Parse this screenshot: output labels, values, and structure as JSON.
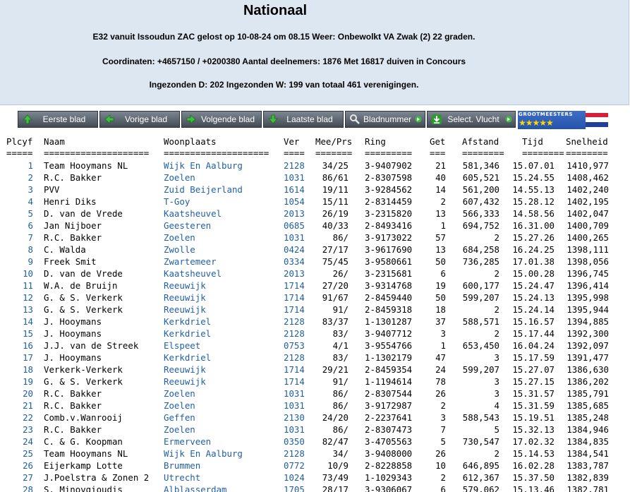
{
  "header": {
    "title": "Nationaal",
    "line1": "E32 vanuit Issoudun ZAC gelost op 10-08-24 om 08.15 Weer: Onbewolkt VA Zwak (2) 22 graden.",
    "line2": "Coordinaten: +4657150 / +0200380 Aantal deelnemers: 1876 Met 16817 duiven in Concours",
    "line3": "Ingezonden D: 202 Ingezonden W: 199 van totaal 461 verenigingen."
  },
  "toolbar": {
    "first": "Eerste blad",
    "prev": "Vorige blad",
    "next": "Volgende blad",
    "last": "Laatste blad",
    "page": "Bladnummer",
    "select": "Select. Vlucht"
  },
  "badge": {
    "text": "GROOTMEESTERS",
    "stars": "★★★★★"
  },
  "colors": {
    "header_bg": "#dde7f1",
    "link": "#2060a8",
    "ver": "#1f5fa0",
    "button": "#555f69"
  },
  "table": {
    "headers": {
      "plcyf": "Plcyf",
      "naam": "Naam",
      "woonplaats": "Woonplaats",
      "ver": "Ver",
      "meeprs": "Mee/Prs",
      "ring": "Ring",
      "get": "Get",
      "afstand": "Afstand",
      "tijd": "Tijd",
      "snelheid": "Snelheid"
    },
    "underlines": {
      "plcyf": "=====",
      "naam": "====================",
      "woonplaats": "====================",
      "ver": "====",
      "meeprs": "=======",
      "ring": "=========",
      "get": "===",
      "afstand": "========",
      "tijd": "========",
      "snelheid": "========"
    },
    "rows": [
      {
        "pl": "1",
        "naam": "Team Hooymans NL",
        "woon": "Wijk En Aalburg",
        "ver": "2128",
        "mp": "34/25",
        "ring": "3-9407902",
        "get": "21",
        "afst": "581,346",
        "tijd": "15.07.01",
        "snel": "1410,977"
      },
      {
        "pl": "2",
        "naam": "R.C. Bakker",
        "woon": "Zoelen",
        "ver": "1031",
        "mp": "86/61",
        "ring": "2-8307598",
        "get": "40",
        "afst": "605,521",
        "tijd": "15.24.55",
        "snel": "1408,462"
      },
      {
        "pl": "3",
        "naam": "PVV",
        "woon": "Zuid Beijerland",
        "ver": "1614",
        "mp": "19/11",
        "ring": "3-9284562",
        "get": "14",
        "afst": "561,200",
        "tijd": "14.55.13",
        "snel": "1402,240"
      },
      {
        "pl": "4",
        "naam": "Henri Diks",
        "woon": "T-Goy",
        "ver": "1054",
        "mp": "15/11",
        "ring": "2-8314459",
        "get": "2",
        "afst": "607,432",
        "tijd": "15.28.12",
        "snel": "1402,195"
      },
      {
        "pl": "5",
        "naam": "D. van de Vrede",
        "woon": "Kaatsheuvel",
        "ver": "2013",
        "mp": "26/19",
        "ring": "3-2315820",
        "get": "13",
        "afst": "566,333",
        "tijd": "14.58.56",
        "snel": "1402,047"
      },
      {
        "pl": "6",
        "naam": "Jan Nijboer",
        "woon": "Geesteren",
        "ver": "0685",
        "mp": "40/33",
        "ring": "2-8493416",
        "get": "1",
        "afst": "694,752",
        "tijd": "16.31.00",
        "snel": "1400,709"
      },
      {
        "pl": "7",
        "naam": "R.C. Bakker",
        "woon": "Zoelen",
        "ver": "1031",
        "mp": "86/",
        "ring": "3-9173022",
        "get": "57",
        "afst": "2",
        "tijd": "15.27.26",
        "snel": "1400,265"
      },
      {
        "pl": "8",
        "naam": "C. Walda",
        "woon": "Zwolle",
        "ver": "0424",
        "mp": "27/17",
        "ring": "3-9617690",
        "get": "13",
        "afst": "684,258",
        "tijd": "16.24.25",
        "snel": "1398,111"
      },
      {
        "pl": "9",
        "naam": "Freek Smit",
        "woon": "Zwartemeer",
        "ver": "0334",
        "mp": "75/45",
        "ring": "3-9580661",
        "get": "50",
        "afst": "736,285",
        "tijd": "17.01.38",
        "snel": "1398,056"
      },
      {
        "pl": "10",
        "naam": "D. van de Vrede",
        "woon": "Kaatsheuvel",
        "ver": "2013",
        "mp": "26/",
        "ring": "3-2315681",
        "get": "6",
        "afst": "2",
        "tijd": "15.00.28",
        "snel": "1396,745"
      },
      {
        "pl": "11",
        "naam": "W.A. de Bruijn",
        "woon": "Reeuwijk",
        "ver": "1714",
        "mp": "27/20",
        "ring": "3-9314768",
        "get": "19",
        "afst": "600,177",
        "tijd": "15.24.47",
        "snel": "1396,414"
      },
      {
        "pl": "12",
        "naam": "G. & S. Verkerk",
        "woon": "Reeuwijk",
        "ver": "1714",
        "mp": "91/67",
        "ring": "2-8459440",
        "get": "50",
        "afst": "599,207",
        "tijd": "15.24.13",
        "snel": "1395,998"
      },
      {
        "pl": "13",
        "naam": "G. & S. Verkerk",
        "woon": "Reeuwijk",
        "ver": "1714",
        "mp": "91/",
        "ring": "2-8459318",
        "get": "18",
        "afst": "2",
        "tijd": "15.24.14",
        "snel": "1395,944"
      },
      {
        "pl": "14",
        "naam": "J. Hooymans",
        "woon": "Kerkdriel",
        "ver": "2128",
        "mp": "83/37",
        "ring": "1-1301287",
        "get": "37",
        "afst": "588,571",
        "tijd": "15.16.57",
        "snel": "1394,885"
      },
      {
        "pl": "15",
        "naam": "J. Hooymans",
        "woon": "Kerkdriel",
        "ver": "2128",
        "mp": "83/",
        "ring": "3-9407712",
        "get": "3",
        "afst": "2",
        "tijd": "15.17.44",
        "snel": "1392,300"
      },
      {
        "pl": "16",
        "naam": "J.J. van de Streek",
        "woon": "Elspeet",
        "ver": "0753",
        "mp": "4/1",
        "ring": "3-9554766",
        "get": "1",
        "afst": "653,450",
        "tijd": "16.04.24",
        "snel": "1392,097"
      },
      {
        "pl": "17",
        "naam": "J. Hooymans",
        "woon": "Kerkdriel",
        "ver": "2128",
        "mp": "83/",
        "ring": "1-1302179",
        "get": "47",
        "afst": "3",
        "tijd": "15.17.59",
        "snel": "1391,477"
      },
      {
        "pl": "18",
        "naam": "Verkerk-Verkerk",
        "woon": "Reeuwijk",
        "ver": "1714",
        "mp": "29/21",
        "ring": "2-8459354",
        "get": "24",
        "afst": "599,207",
        "tijd": "15.27.07",
        "snel": "1386,630"
      },
      {
        "pl": "19",
        "naam": "G. & S. Verkerk",
        "woon": "Reeuwijk",
        "ver": "1714",
        "mp": "91/",
        "ring": "1-1194614",
        "get": "78",
        "afst": "3",
        "tijd": "15.27.15",
        "snel": "1386,202"
      },
      {
        "pl": "20",
        "naam": "R.C. Bakker",
        "woon": "Zoelen",
        "ver": "1031",
        "mp": "86/",
        "ring": "2-8307544",
        "get": "26",
        "afst": "3",
        "tijd": "15.31.57",
        "snel": "1385,791"
      },
      {
        "pl": "21",
        "naam": "R.C. Bakker",
        "woon": "Zoelen",
        "ver": "1031",
        "mp": "86/",
        "ring": "3-9172987",
        "get": "2",
        "afst": "4",
        "tijd": "15.31.59",
        "snel": "1385,685"
      },
      {
        "pl": "22",
        "naam": "Comb.v.Wanrooij",
        "woon": "Geffen",
        "ver": "2130",
        "mp": "24/20",
        "ring": "2-2237641",
        "get": "3",
        "afst": "588,543",
        "tijd": "15.19.51",
        "snel": "1385,248"
      },
      {
        "pl": "23",
        "naam": "R.C. Bakker",
        "woon": "Zoelen",
        "ver": "1031",
        "mp": "86/",
        "ring": "2-8307473",
        "get": "7",
        "afst": "5",
        "tijd": "15.32.13",
        "snel": "1384,946"
      },
      {
        "pl": "24",
        "naam": "C. & G. Koopman",
        "woon": "Ermerveen",
        "ver": "0350",
        "mp": "82/47",
        "ring": "3-4705563",
        "get": "5",
        "afst": "730,547",
        "tijd": "17.02.32",
        "snel": "1384,835"
      },
      {
        "pl": "25",
        "naam": "Team Hooymans NL",
        "woon": "Wijk En Aalburg",
        "ver": "2128",
        "mp": "34/",
        "ring": "3-9408000",
        "get": "26",
        "afst": "2",
        "tijd": "15.14.53",
        "snel": "1384,541"
      },
      {
        "pl": "26",
        "naam": "Eijerkamp Lotte",
        "woon": "Brummen",
        "ver": "0772",
        "mp": "10/9",
        "ring": "2-8228858",
        "get": "10",
        "afst": "646,895",
        "tijd": "16.02.28",
        "snel": "1383,787"
      },
      {
        "pl": "27",
        "naam": "J.Poelstra & Zonen 2",
        "woon": "Utrecht",
        "ver": "1024",
        "mp": "73/49",
        "ring": "1-1029343",
        "get": "2",
        "afst": "612,367",
        "tijd": "15.37.50",
        "snel": "1382,839"
      },
      {
        "pl": "28",
        "naam": "S. Minovgioudis",
        "woon": "Alblasserdam",
        "ver": "1705",
        "mp": "28/17",
        "ring": "3-9306067",
        "get": "6",
        "afst": "579,062",
        "tijd": "15.13.46",
        "snel": "1382,781"
      }
    ]
  }
}
